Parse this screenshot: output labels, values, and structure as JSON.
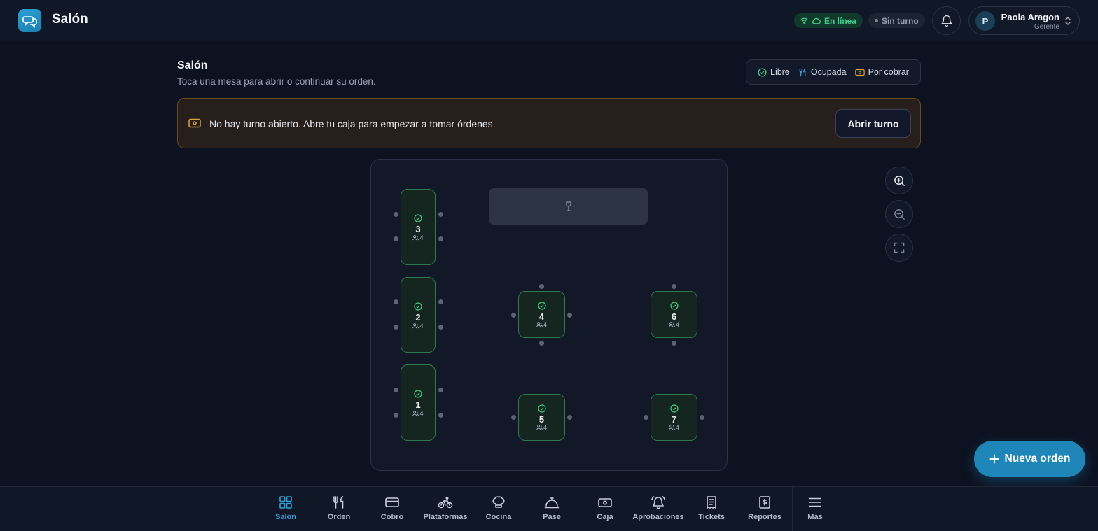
{
  "header": {
    "title": "Salón",
    "status_online": "En línea",
    "status_shift": "Sin turno",
    "user": {
      "initial": "P",
      "name": "Paola Aragon",
      "role": "Gerente"
    }
  },
  "page": {
    "title": "Salón",
    "subtitle": "Toca una mesa para abrir o continuar su orden."
  },
  "legend": {
    "free": "Libre",
    "occupied": "Ocupada",
    "to_charge": "Por cobrar"
  },
  "banner": {
    "message": "No hay turno abierto. Abre tu caja para empezar a tomar órdenes.",
    "button": "Abrir turno"
  },
  "tables": [
    {
      "number": "3",
      "seats": "4",
      "status": "free"
    },
    {
      "number": "2",
      "seats": "4",
      "status": "free"
    },
    {
      "number": "1",
      "seats": "4",
      "status": "free"
    },
    {
      "number": "4",
      "seats": "4",
      "status": "free"
    },
    {
      "number": "6",
      "seats": "4",
      "status": "free"
    },
    {
      "number": "5",
      "seats": "4",
      "status": "free"
    },
    {
      "number": "7",
      "seats": "4",
      "status": "free"
    }
  ],
  "fab": {
    "label": "Nueva orden"
  },
  "nav": {
    "items": [
      {
        "label": "Salón",
        "icon": "grid-icon",
        "active": true
      },
      {
        "label": "Orden",
        "icon": "utensils-icon"
      },
      {
        "label": "Cobro",
        "icon": "card-icon"
      },
      {
        "label": "Plataformas",
        "icon": "bike-icon"
      },
      {
        "label": "Cocina",
        "icon": "chef-hat-icon"
      },
      {
        "label": "Pase",
        "icon": "service-bell-icon"
      },
      {
        "label": "Caja",
        "icon": "cash-icon"
      },
      {
        "label": "Aprobaciones",
        "icon": "alarm-bell-icon"
      },
      {
        "label": "Tickets",
        "icon": "receipt-icon"
      },
      {
        "label": "Reportes",
        "icon": "report-dollar-icon"
      }
    ],
    "more": "Más"
  },
  "colors": {
    "accent": "#1e86b8",
    "free": "#3fd08a",
    "occupied": "#3b9ad9",
    "to_charge": "#e0a33a"
  }
}
